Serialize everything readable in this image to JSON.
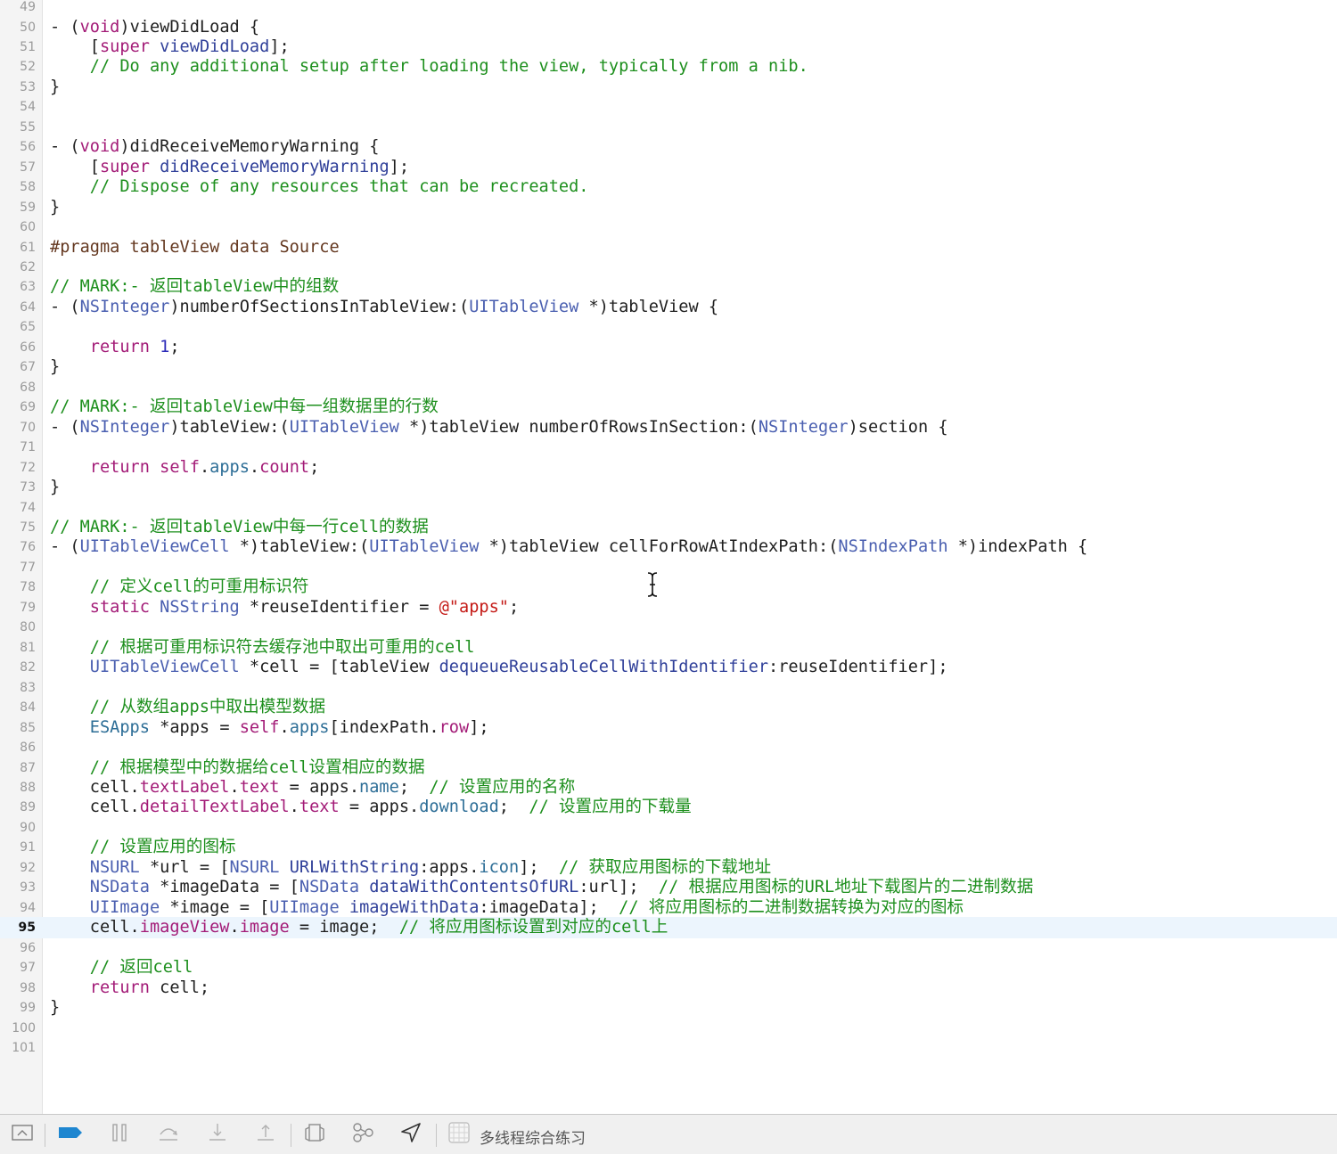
{
  "editor": {
    "current_line": 95,
    "lines": [
      {
        "n": "49",
        "tokens": []
      },
      {
        "n": "50",
        "tokens": [
          [
            "d",
            "- ("
          ],
          [
            "k",
            "void"
          ],
          [
            "d",
            ")viewDidLoad {"
          ]
        ]
      },
      {
        "n": "51",
        "tokens": [
          [
            "d",
            "    ["
          ],
          [
            "k",
            "super"
          ],
          [
            "d",
            " "
          ],
          [
            "m",
            "viewDidLoad"
          ],
          [
            "d",
            "];"
          ]
        ]
      },
      {
        "n": "52",
        "tokens": [
          [
            "c",
            "    // Do any additional setup after loading the view, typically from a nib."
          ]
        ]
      },
      {
        "n": "53",
        "tokens": [
          [
            "d",
            "}"
          ]
        ]
      },
      {
        "n": "54",
        "tokens": []
      },
      {
        "n": "55",
        "tokens": []
      },
      {
        "n": "56",
        "tokens": [
          [
            "d",
            "- ("
          ],
          [
            "k",
            "void"
          ],
          [
            "d",
            ")didReceiveMemoryWarning {"
          ]
        ]
      },
      {
        "n": "57",
        "tokens": [
          [
            "d",
            "    ["
          ],
          [
            "k",
            "super"
          ],
          [
            "d",
            " "
          ],
          [
            "m",
            "didReceiveMemoryWarning"
          ],
          [
            "d",
            "];"
          ]
        ]
      },
      {
        "n": "58",
        "tokens": [
          [
            "c",
            "    // Dispose of any resources that can be recreated."
          ]
        ]
      },
      {
        "n": "59",
        "tokens": [
          [
            "d",
            "}"
          ]
        ]
      },
      {
        "n": "60",
        "tokens": []
      },
      {
        "n": "61",
        "tokens": [
          [
            "pp",
            "#pragma tableView data Source"
          ]
        ]
      },
      {
        "n": "62",
        "tokens": []
      },
      {
        "n": "63",
        "tokens": [
          [
            "c",
            "// MARK:- 返回tableView中的组数"
          ]
        ]
      },
      {
        "n": "64",
        "tokens": [
          [
            "d",
            "- ("
          ],
          [
            "t",
            "NSInteger"
          ],
          [
            "d",
            ")numberOfSectionsInTableView:("
          ],
          [
            "t",
            "UITableView"
          ],
          [
            "d",
            " *)tableView {"
          ]
        ]
      },
      {
        "n": "65",
        "tokens": []
      },
      {
        "n": "66",
        "tokens": [
          [
            "d",
            "    "
          ],
          [
            "k",
            "return"
          ],
          [
            "d",
            " "
          ],
          [
            "n",
            "1"
          ],
          [
            "d",
            ";"
          ]
        ]
      },
      {
        "n": "67",
        "tokens": [
          [
            "d",
            "}"
          ]
        ]
      },
      {
        "n": "68",
        "tokens": []
      },
      {
        "n": "69",
        "tokens": [
          [
            "c",
            "// MARK:- 返回tableView中每一组数据里的行数"
          ]
        ]
      },
      {
        "n": "70",
        "tokens": [
          [
            "d",
            "- ("
          ],
          [
            "t",
            "NSInteger"
          ],
          [
            "d",
            ")tableView:("
          ],
          [
            "t",
            "UITableView"
          ],
          [
            "d",
            " *)tableView numberOfRowsInSection:("
          ],
          [
            "t",
            "NSInteger"
          ],
          [
            "d",
            ")section {"
          ]
        ]
      },
      {
        "n": "71",
        "tokens": []
      },
      {
        "n": "72",
        "tokens": [
          [
            "d",
            "    "
          ],
          [
            "k",
            "return"
          ],
          [
            "d",
            " "
          ],
          [
            "k",
            "self"
          ],
          [
            "d",
            "."
          ],
          [
            "p",
            "apps"
          ],
          [
            "d",
            "."
          ],
          [
            "k",
            "count"
          ],
          [
            "d",
            ";"
          ]
        ]
      },
      {
        "n": "73",
        "tokens": [
          [
            "d",
            "}"
          ]
        ]
      },
      {
        "n": "74",
        "tokens": []
      },
      {
        "n": "75",
        "tokens": [
          [
            "c",
            "// MARK:- 返回tableView中每一行cell的数据"
          ]
        ]
      },
      {
        "n": "76",
        "tokens": [
          [
            "d",
            "- ("
          ],
          [
            "t",
            "UITableViewCell"
          ],
          [
            "d",
            " *)tableView:("
          ],
          [
            "t",
            "UITableView"
          ],
          [
            "d",
            " *)tableView cellForRowAtIndexPath:("
          ],
          [
            "t",
            "NSIndexPath"
          ],
          [
            "d",
            " *)indexPath {"
          ]
        ]
      },
      {
        "n": "77",
        "tokens": []
      },
      {
        "n": "78",
        "tokens": [
          [
            "c",
            "    // 定义cell的可重用标识符"
          ]
        ]
      },
      {
        "n": "79",
        "tokens": [
          [
            "d",
            "    "
          ],
          [
            "k",
            "static"
          ],
          [
            "d",
            " "
          ],
          [
            "t",
            "NSString"
          ],
          [
            "d",
            " *reuseIdentifier = "
          ],
          [
            "s",
            "@\"apps\""
          ],
          [
            "d",
            ";"
          ]
        ]
      },
      {
        "n": "80",
        "tokens": []
      },
      {
        "n": "81",
        "tokens": [
          [
            "c",
            "    // 根据可重用标识符去缓存池中取出可重用的cell"
          ]
        ]
      },
      {
        "n": "82",
        "tokens": [
          [
            "d",
            "    "
          ],
          [
            "t",
            "UITableViewCell"
          ],
          [
            "d",
            " *cell = [tableView "
          ],
          [
            "m",
            "dequeueReusableCellWithIdentifier"
          ],
          [
            "d",
            ":reuseIdentifier];"
          ]
        ]
      },
      {
        "n": "83",
        "tokens": []
      },
      {
        "n": "84",
        "tokens": [
          [
            "c",
            "    // 从数组apps中取出模型数据"
          ]
        ]
      },
      {
        "n": "85",
        "tokens": [
          [
            "d",
            "    "
          ],
          [
            "p",
            "ESApps"
          ],
          [
            "d",
            " *apps = "
          ],
          [
            "k",
            "self"
          ],
          [
            "d",
            "."
          ],
          [
            "p",
            "apps"
          ],
          [
            "d",
            "[indexPath."
          ],
          [
            "k",
            "row"
          ],
          [
            "d",
            "];"
          ]
        ]
      },
      {
        "n": "86",
        "tokens": []
      },
      {
        "n": "87",
        "tokens": [
          [
            "c",
            "    // 根据模型中的数据给cell设置相应的数据"
          ]
        ]
      },
      {
        "n": "88",
        "tokens": [
          [
            "d",
            "    cell."
          ],
          [
            "k",
            "textLabel"
          ],
          [
            "d",
            "."
          ],
          [
            "k",
            "text"
          ],
          [
            "d",
            " = apps."
          ],
          [
            "p",
            "name"
          ],
          [
            "d",
            ";  "
          ],
          [
            "c",
            "// 设置应用的名称"
          ]
        ]
      },
      {
        "n": "89",
        "tokens": [
          [
            "d",
            "    cell."
          ],
          [
            "k",
            "detailTextLabel"
          ],
          [
            "d",
            "."
          ],
          [
            "k",
            "text"
          ],
          [
            "d",
            " = apps."
          ],
          [
            "p",
            "download"
          ],
          [
            "d",
            ";  "
          ],
          [
            "c",
            "// 设置应用的下载量"
          ]
        ]
      },
      {
        "n": "90",
        "tokens": []
      },
      {
        "n": "91",
        "tokens": [
          [
            "c",
            "    // 设置应用的图标"
          ]
        ]
      },
      {
        "n": "92",
        "tokens": [
          [
            "d",
            "    "
          ],
          [
            "t",
            "NSURL"
          ],
          [
            "d",
            " *url = ["
          ],
          [
            "t",
            "NSURL"
          ],
          [
            "d",
            " "
          ],
          [
            "m",
            "URLWithString"
          ],
          [
            "d",
            ":apps."
          ],
          [
            "p",
            "icon"
          ],
          [
            "d",
            "];  "
          ],
          [
            "c",
            "// 获取应用图标的下载地址"
          ]
        ]
      },
      {
        "n": "93",
        "tokens": [
          [
            "d",
            "    "
          ],
          [
            "t",
            "NSData"
          ],
          [
            "d",
            " *imageData = ["
          ],
          [
            "t",
            "NSData"
          ],
          [
            "d",
            " "
          ],
          [
            "m",
            "dataWithContentsOfURL"
          ],
          [
            "d",
            ":url];  "
          ],
          [
            "c",
            "// 根据应用图标的URL地址下载图片的二进制数据"
          ]
        ]
      },
      {
        "n": "94",
        "tokens": [
          [
            "d",
            "    "
          ],
          [
            "t",
            "UIImage"
          ],
          [
            "d",
            " *image = ["
          ],
          [
            "t",
            "UIImage"
          ],
          [
            "d",
            " "
          ],
          [
            "m",
            "imageWithData"
          ],
          [
            "d",
            ":imageData];  "
          ],
          [
            "c",
            "// 将应用图标的二进制数据转换为对应的图标"
          ]
        ]
      },
      {
        "n": "95",
        "tokens": [
          [
            "d",
            "    cell."
          ],
          [
            "k",
            "imageView"
          ],
          [
            "d",
            "."
          ],
          [
            "k",
            "image"
          ],
          [
            "d",
            " = image;  "
          ],
          [
            "c",
            "// 将应用图标设置到对应的cell上"
          ]
        ]
      },
      {
        "n": "96",
        "tokens": []
      },
      {
        "n": "97",
        "tokens": [
          [
            "c",
            "    // 返回cell"
          ]
        ]
      },
      {
        "n": "98",
        "tokens": [
          [
            "d",
            "    "
          ],
          [
            "k",
            "return"
          ],
          [
            "d",
            " cell;"
          ]
        ]
      },
      {
        "n": "99",
        "tokens": [
          [
            "d",
            "}"
          ]
        ]
      },
      {
        "n": "100",
        "tokens": []
      },
      {
        "n": "101",
        "tokens": []
      }
    ]
  },
  "bottombar": {
    "target_name": "多线程综合练习",
    "buttons": [
      {
        "name": "hide-debug-area-button",
        "icon": "panel-toggle-icon"
      },
      {
        "name": "breakpoints-toggle-button",
        "icon": "breakpoint-icon"
      },
      {
        "name": "pause-button",
        "icon": "pause-icon"
      },
      {
        "name": "step-over-button",
        "icon": "step-over-icon"
      },
      {
        "name": "step-into-button",
        "icon": "step-into-icon"
      },
      {
        "name": "step-out-button",
        "icon": "step-out-icon"
      },
      {
        "name": "view-debugger-button",
        "icon": "view-hierarchy-icon"
      },
      {
        "name": "memory-graph-button",
        "icon": "memory-graph-icon"
      },
      {
        "name": "simulate-location-button",
        "icon": "location-arrow-icon"
      },
      {
        "name": "target-button",
        "icon": "app-target-icon"
      }
    ],
    "accent_color": "#1e86d0"
  }
}
